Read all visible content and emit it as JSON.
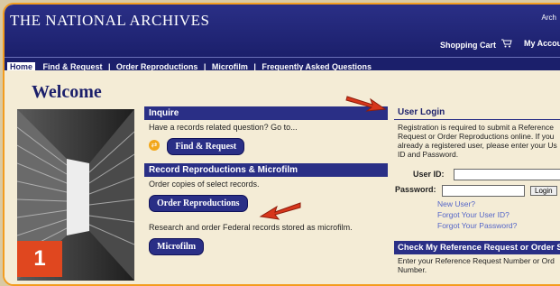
{
  "header": {
    "title": "THE NATIONAL ARCHIVES",
    "right_label": "Arch",
    "cart_label": "Shopping Cart",
    "cart_icon": "cart-icon",
    "account_label": "My Account"
  },
  "nav": {
    "items": [
      "Home",
      "Find & Request",
      "Order Reproductions",
      "Microfilm",
      "Frequently Asked Questions"
    ]
  },
  "main": {
    "welcome": "Welcome",
    "badge": "1",
    "inquire_head": "Inquire",
    "inquire_text": "Have a records related question? Go to...",
    "find_button": "Find & Request",
    "repro_head": "Record Reproductions & Microfilm",
    "repro_text": "Order copies of select records.",
    "order_button": "Order Reproductions",
    "microfilm_text": "Research and order Federal records stored as microfilm.",
    "microfilm_button": "Microfilm"
  },
  "login": {
    "head": "User Login",
    "text_lines": [
      "Registration is required to submit a Reference",
      "Request or Order Reproductions online. If you",
      "already a registered user, please enter your Us",
      "ID and Password."
    ],
    "user_id_label": "User ID:",
    "password_label": "Password:",
    "login_button": "Login",
    "new_user": "New User?",
    "forgot_id": "Forgot Your User ID?",
    "forgot_password": "Forgot Your Password?"
  },
  "check": {
    "head": "Check My Reference Request or Order St",
    "text_lines": [
      "Enter your Reference Request Number or Ord",
      "Number."
    ]
  },
  "colors": {
    "navy": "#1b1f6b",
    "accent_orange": "#e0471f",
    "frame_orange": "#f39c1e",
    "link_blue": "#5566c8"
  }
}
